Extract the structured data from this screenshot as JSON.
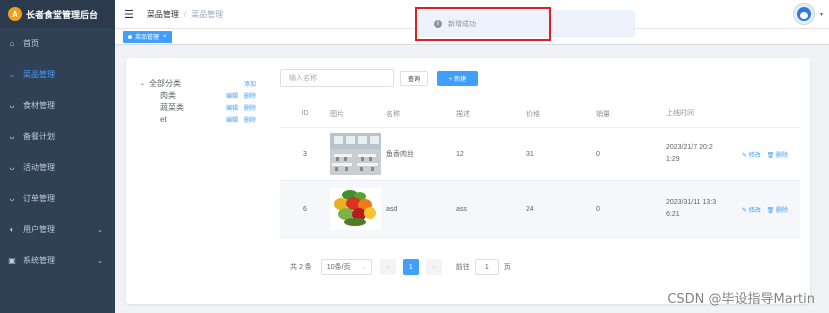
{
  "app": {
    "brand_logo_letter": "A",
    "brand_title": "长者食堂管理后台"
  },
  "sidebar": {
    "items": [
      {
        "label": "首页",
        "icon": "home-icon",
        "glyph": "⌂",
        "active": false,
        "has_arrow": false
      },
      {
        "label": "菜品管理",
        "icon": "user-icon",
        "glyph": "ᴗ",
        "active": true,
        "has_arrow": false
      },
      {
        "label": "食材管理",
        "icon": "user-icon",
        "glyph": "ᴗ",
        "active": false,
        "has_arrow": false
      },
      {
        "label": "备餐计划",
        "icon": "user-icon",
        "glyph": "ᴗ",
        "active": false,
        "has_arrow": false
      },
      {
        "label": "活动管理",
        "icon": "user-icon",
        "glyph": "ᴗ",
        "active": false,
        "has_arrow": false
      },
      {
        "label": "订单管理",
        "icon": "user-icon",
        "glyph": "ᴗ",
        "active": false,
        "has_arrow": false
      },
      {
        "label": "用户管理",
        "icon": "user-group-icon",
        "glyph": "◐",
        "active": false,
        "has_arrow": true
      },
      {
        "label": "系统管理",
        "icon": "system-icon",
        "glyph": "▣",
        "active": false,
        "has_arrow": true
      }
    ],
    "arrow_glyph": "⌄"
  },
  "header": {
    "hamburger_glyph": "☰",
    "breadcrumb": [
      "菜品管理",
      "菜品管理"
    ],
    "breadcrumb_sep": "/",
    "avatar_caret": "▾"
  },
  "tags": {
    "active_tag": "菜品管理",
    "close_glyph": "×"
  },
  "toast": {
    "icon_glyph": "i",
    "message": "新增成功"
  },
  "tree": {
    "root_label": "全部分类",
    "root_caret": "⌄",
    "root_action": "添加",
    "children": [
      {
        "label": "肉类",
        "edit": "编辑",
        "delete": "删除"
      },
      {
        "label": "蔬菜类",
        "edit": "编辑",
        "delete": "删除"
      },
      {
        "label": "et",
        "edit": "编辑",
        "delete": "删除"
      }
    ]
  },
  "toolbar": {
    "search_placeholder": "输入名称",
    "query_label": "查询",
    "add_label": "+ 新建"
  },
  "table": {
    "columns": [
      "ID",
      "图片",
      "名称",
      "描述",
      "价格",
      "销量",
      "上线时间"
    ],
    "rows": [
      {
        "id": "3",
        "image": "canteen",
        "name": "鱼香肉丝",
        "desc": "12",
        "price": "31",
        "sales": "0",
        "time_line1": "2023/21/7 20:2",
        "time_line2": "1:29",
        "edit": "✎ 修改",
        "delete": "🗑 删除"
      },
      {
        "id": "6",
        "image": "vegetables",
        "name": "asd",
        "desc": "ass",
        "price": "24",
        "sales": "0",
        "time_line1": "2023/31/11 13:3",
        "time_line2": "6:21",
        "edit": "✎ 修改",
        "delete": "🗑 删除"
      }
    ]
  },
  "pagination": {
    "total": "共 2 条",
    "page_size": "10条/页",
    "size_caret": "⌄",
    "prev": "‹",
    "current": "1",
    "next": "›",
    "goto_prefix": "前往",
    "goto_value": "1",
    "goto_suffix": "页"
  },
  "watermark": "CSDN @毕设指导Martin",
  "colors": {
    "sidebar_bg": "#304156",
    "accent": "#409eff",
    "highlight": "#e02020"
  }
}
